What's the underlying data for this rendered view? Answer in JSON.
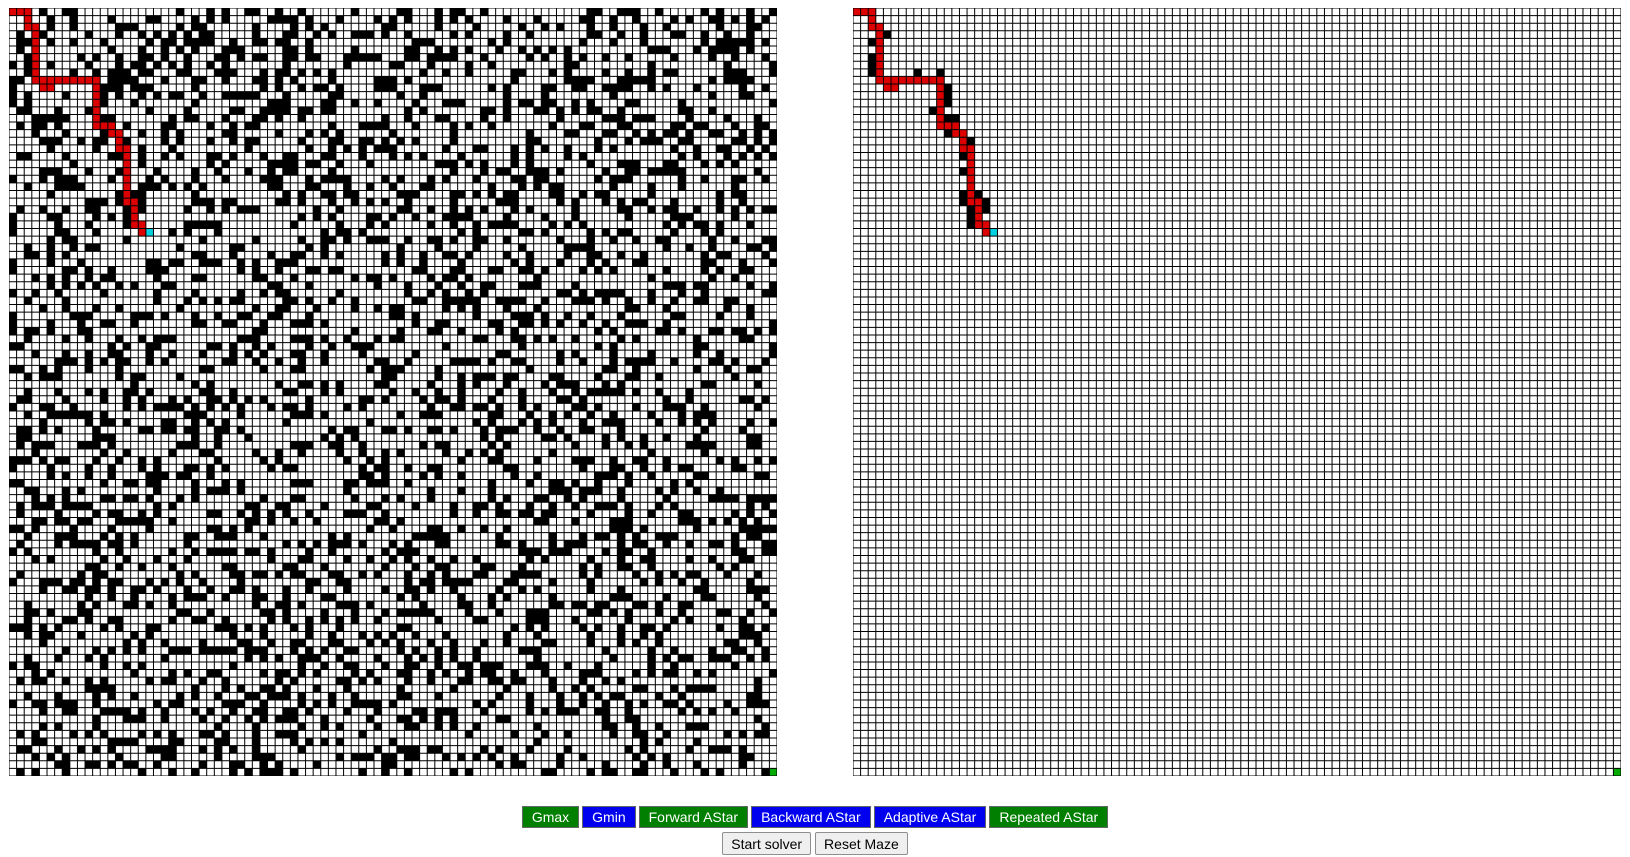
{
  "maze": {
    "rows": 101,
    "cols": 101,
    "wall_density": 0.3,
    "seed": 7,
    "path": [
      [
        0,
        0
      ],
      [
        0,
        1
      ],
      [
        0,
        2
      ],
      [
        1,
        2
      ],
      [
        2,
        2
      ],
      [
        2,
        3
      ],
      [
        3,
        3
      ],
      [
        4,
        3
      ],
      [
        5,
        3
      ],
      [
        6,
        3
      ],
      [
        7,
        3
      ],
      [
        8,
        3
      ],
      [
        9,
        3
      ],
      [
        9,
        4
      ],
      [
        10,
        4
      ],
      [
        10,
        5
      ],
      [
        9,
        5
      ],
      [
        9,
        6
      ],
      [
        9,
        7
      ],
      [
        9,
        8
      ],
      [
        9,
        9
      ],
      [
        9,
        10
      ],
      [
        9,
        11
      ],
      [
        10,
        11
      ],
      [
        11,
        11
      ],
      [
        12,
        11
      ],
      [
        13,
        11
      ],
      [
        14,
        11
      ],
      [
        15,
        11
      ],
      [
        15,
        12
      ],
      [
        15,
        13
      ],
      [
        16,
        13
      ],
      [
        16,
        14
      ],
      [
        17,
        14
      ],
      [
        18,
        14
      ],
      [
        18,
        15
      ],
      [
        19,
        15
      ],
      [
        20,
        15
      ],
      [
        21,
        15
      ],
      [
        22,
        15
      ],
      [
        23,
        15
      ],
      [
        24,
        15
      ],
      [
        25,
        15
      ],
      [
        25,
        16
      ],
      [
        26,
        16
      ],
      [
        27,
        16
      ],
      [
        28,
        16
      ],
      [
        28,
        17
      ],
      [
        29,
        17
      ],
      [
        29,
        18
      ]
    ],
    "agent": [
      29,
      18
    ],
    "goal": [
      100,
      100
    ]
  },
  "colors": {
    "wall": "#000000",
    "open": "#ffffff",
    "grid": "#000000",
    "path": "#dd0000",
    "agent": "#00d0e0",
    "goal": "#00aa00",
    "btn_green": "#007f00",
    "btn_blue": "#0000ee"
  },
  "algorithm_buttons": [
    {
      "label": "Gmax",
      "color": "#007f00"
    },
    {
      "label": "Gmin",
      "color": "#0000ee"
    },
    {
      "label": "Forward AStar",
      "color": "#007f00"
    },
    {
      "label": "Backward AStar",
      "color": "#0000ee"
    },
    {
      "label": "Adaptive AStar",
      "color": "#0000ee"
    },
    {
      "label": "Repeated AStar",
      "color": "#007f00"
    }
  ],
  "actions": {
    "start_label": "Start solver",
    "reset_label": "Reset Maze"
  }
}
